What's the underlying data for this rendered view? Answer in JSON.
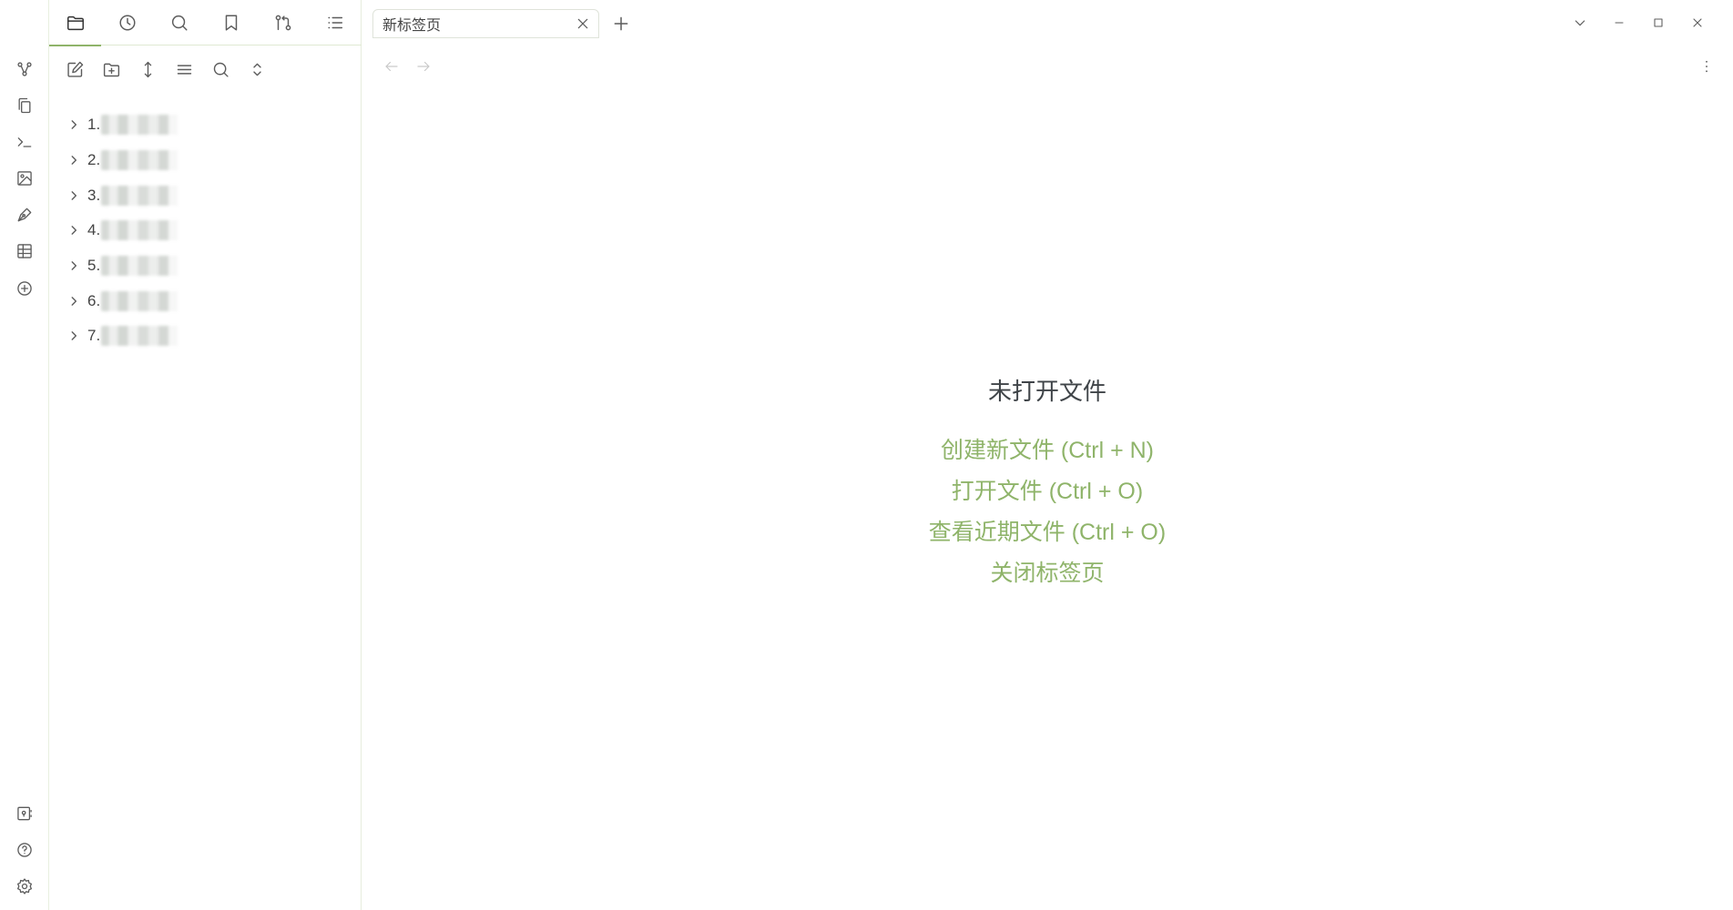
{
  "sidebar": {
    "tabs": [
      {
        "name": "file-explorer",
        "icon": "folder-icon",
        "active": true
      },
      {
        "name": "recent-files",
        "icon": "clock-icon",
        "active": false
      },
      {
        "name": "search",
        "icon": "search-icon",
        "active": false
      },
      {
        "name": "bookmarks",
        "icon": "bookmark-icon",
        "active": false
      },
      {
        "name": "git",
        "icon": "git-compare-icon",
        "active": false
      },
      {
        "name": "outline",
        "icon": "list-icon",
        "active": false
      }
    ],
    "toolbar": [
      "new-note-icon",
      "new-folder-icon",
      "sort-icon",
      "menu-icon",
      "search-icon",
      "collapse-icon"
    ],
    "tree": [
      {
        "label": "1."
      },
      {
        "label": "2."
      },
      {
        "label": "3."
      },
      {
        "label": "4."
      },
      {
        "label": "5."
      },
      {
        "label": "6."
      },
      {
        "label": "7."
      }
    ]
  },
  "ribbon": {
    "top": [
      "graph-icon",
      "copy-icon",
      "terminal-icon",
      "image-icon",
      "pen-icon",
      "table-icon",
      "plus-circle-icon"
    ],
    "bottom": [
      "vault-icon",
      "help-icon",
      "settings-icon"
    ]
  },
  "tab": {
    "title": "新标签页"
  },
  "empty_state": {
    "title": "未打开文件",
    "actions": {
      "create": "创建新文件 (Ctrl + N)",
      "open": "打开文件 (Ctrl + O)",
      "recent": "查看近期文件 (Ctrl + O)",
      "close": "关闭标签页"
    }
  },
  "colors": {
    "accent": "#8fb46a",
    "icon": "#5c5c5c",
    "border": "#e6eddd"
  }
}
